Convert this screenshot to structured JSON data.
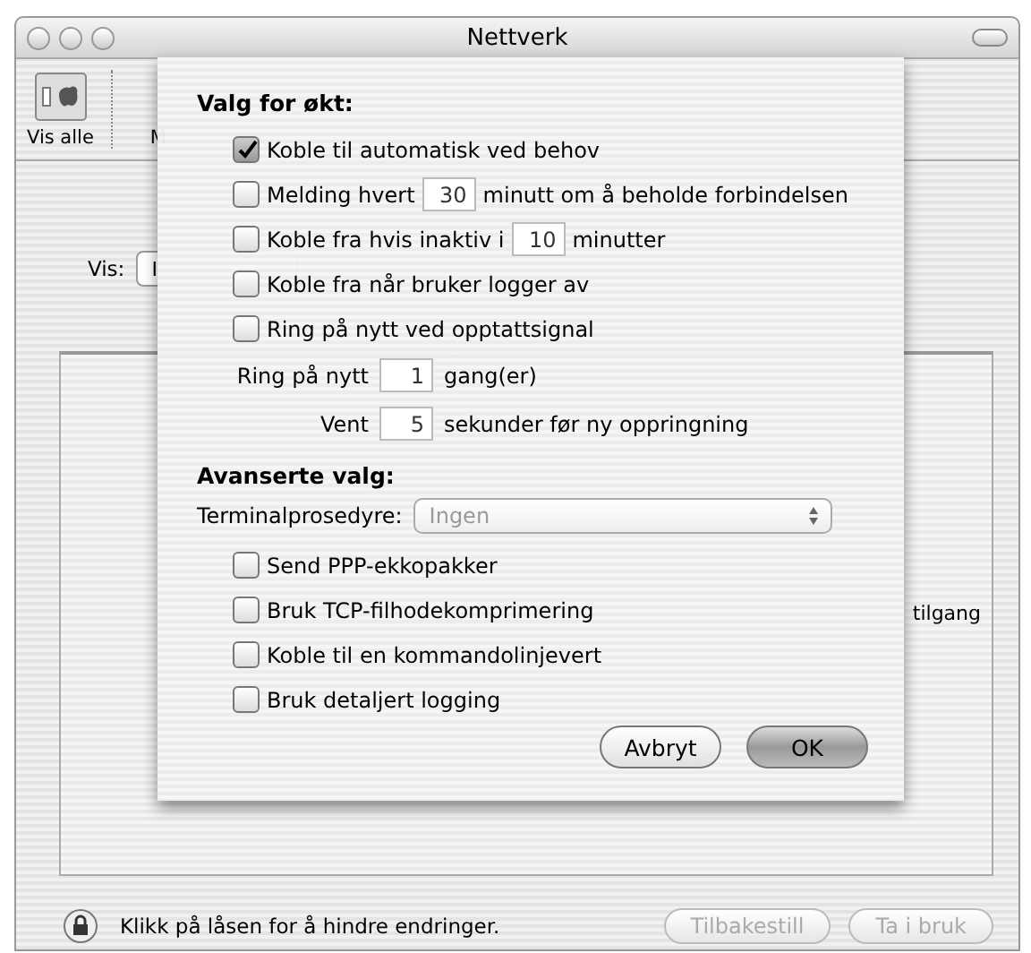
{
  "window": {
    "title": "Nettverk"
  },
  "toolbar": {
    "items": [
      {
        "label": "Vis alle",
        "kind": "apple"
      },
      {
        "label": "M",
        "kind": "blank"
      }
    ]
  },
  "show": {
    "label": "Vis:",
    "value": "I"
  },
  "panel": {
    "text": "tilgang"
  },
  "footer": {
    "lock_text": "Klikk på låsen for å hindre endringer.",
    "buttons": [
      {
        "label": "Tilbakestill",
        "disabled": true
      },
      {
        "label": "Ta i bruk",
        "disabled": true
      }
    ]
  },
  "sheet": {
    "session_heading": "Valg for økt:",
    "session_options": [
      {
        "kind": "check",
        "label": "Koble til automatisk ved behov",
        "checked": true
      },
      {
        "kind": "check_field",
        "before": "Melding hvert",
        "value": "30",
        "after": "minutt om å beholde forbindelsen",
        "checked": false
      },
      {
        "kind": "check_field",
        "before": "Koble fra hvis inaktiv i",
        "value": "10",
        "after": "minutter",
        "checked": false
      },
      {
        "kind": "check",
        "label": "Koble fra når bruker logger av",
        "checked": false
      },
      {
        "kind": "check",
        "label": "Ring på nytt ved opptattsignal",
        "checked": false
      }
    ],
    "redial": [
      {
        "label": "Ring på nytt",
        "value": "1",
        "unit": "gang(er)"
      },
      {
        "label": "Vent",
        "value": "5",
        "unit": "sekunder før ny oppringning"
      }
    ],
    "advanced_heading": "Avanserte valg:",
    "terminal": {
      "label": "Terminalprosedyre:",
      "value": "Ingen",
      "disabled": true
    },
    "advanced_options": [
      {
        "label": "Send PPP-ekkopakker",
        "checked": false
      },
      {
        "label": "Bruk TCP-filhodekomprimering",
        "checked": false
      },
      {
        "label": "Koble til en kommandolinjevert",
        "checked": false
      },
      {
        "label": "Bruk detaljert logging",
        "checked": false
      }
    ],
    "buttons": [
      {
        "label": "Avbryt",
        "default": false
      },
      {
        "label": "OK",
        "default": true
      }
    ]
  }
}
